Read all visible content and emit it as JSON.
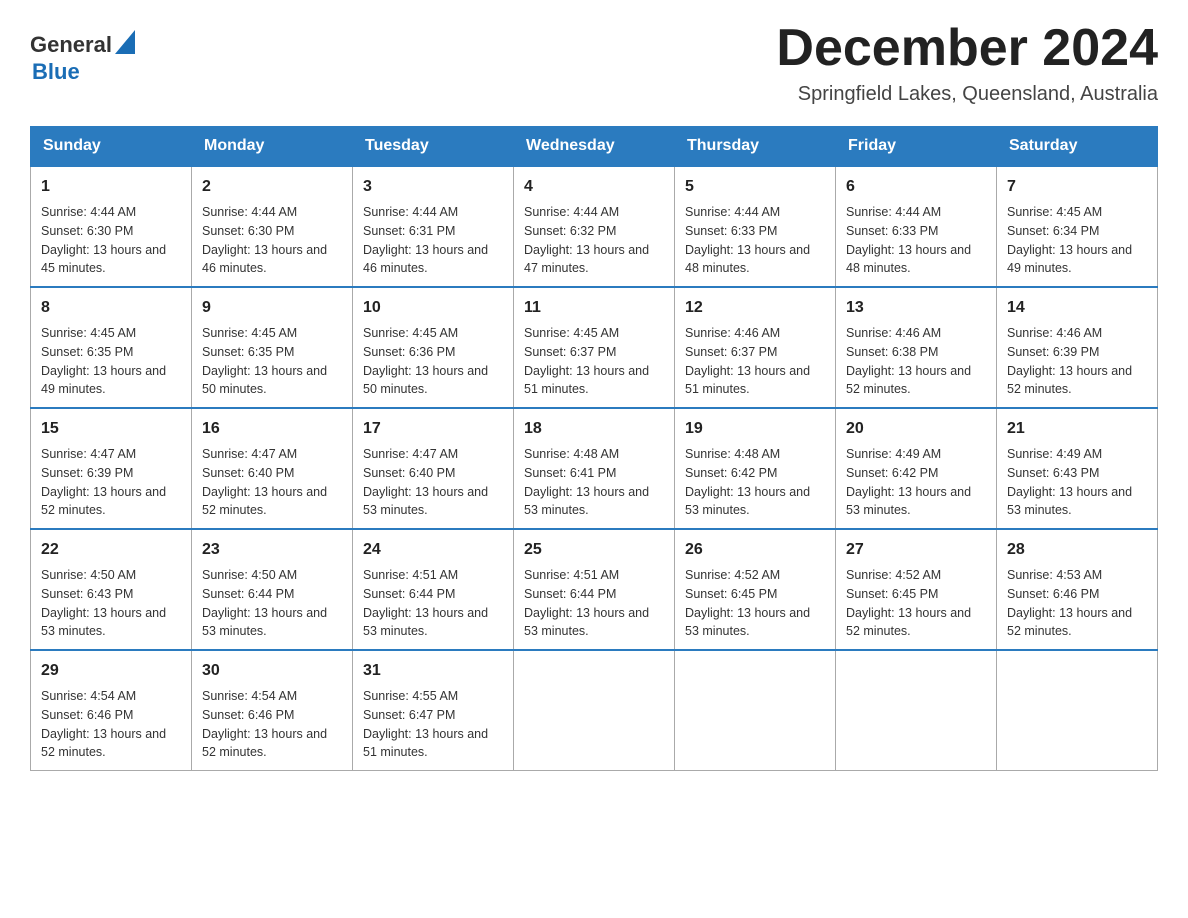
{
  "header": {
    "title": "December 2024",
    "subtitle": "Springfield Lakes, Queensland, Australia",
    "logo_general": "General",
    "logo_blue": "Blue"
  },
  "weekdays": [
    "Sunday",
    "Monday",
    "Tuesday",
    "Wednesday",
    "Thursday",
    "Friday",
    "Saturday"
  ],
  "weeks": [
    [
      {
        "day": "1",
        "sunrise": "4:44 AM",
        "sunset": "6:30 PM",
        "daylight": "13 hours and 45 minutes."
      },
      {
        "day": "2",
        "sunrise": "4:44 AM",
        "sunset": "6:30 PM",
        "daylight": "13 hours and 46 minutes."
      },
      {
        "day": "3",
        "sunrise": "4:44 AM",
        "sunset": "6:31 PM",
        "daylight": "13 hours and 46 minutes."
      },
      {
        "day": "4",
        "sunrise": "4:44 AM",
        "sunset": "6:32 PM",
        "daylight": "13 hours and 47 minutes."
      },
      {
        "day": "5",
        "sunrise": "4:44 AM",
        "sunset": "6:33 PM",
        "daylight": "13 hours and 48 minutes."
      },
      {
        "day": "6",
        "sunrise": "4:44 AM",
        "sunset": "6:33 PM",
        "daylight": "13 hours and 48 minutes."
      },
      {
        "day": "7",
        "sunrise": "4:45 AM",
        "sunset": "6:34 PM",
        "daylight": "13 hours and 49 minutes."
      }
    ],
    [
      {
        "day": "8",
        "sunrise": "4:45 AM",
        "sunset": "6:35 PM",
        "daylight": "13 hours and 49 minutes."
      },
      {
        "day": "9",
        "sunrise": "4:45 AM",
        "sunset": "6:35 PM",
        "daylight": "13 hours and 50 minutes."
      },
      {
        "day": "10",
        "sunrise": "4:45 AM",
        "sunset": "6:36 PM",
        "daylight": "13 hours and 50 minutes."
      },
      {
        "day": "11",
        "sunrise": "4:45 AM",
        "sunset": "6:37 PM",
        "daylight": "13 hours and 51 minutes."
      },
      {
        "day": "12",
        "sunrise": "4:46 AM",
        "sunset": "6:37 PM",
        "daylight": "13 hours and 51 minutes."
      },
      {
        "day": "13",
        "sunrise": "4:46 AM",
        "sunset": "6:38 PM",
        "daylight": "13 hours and 52 minutes."
      },
      {
        "day": "14",
        "sunrise": "4:46 AM",
        "sunset": "6:39 PM",
        "daylight": "13 hours and 52 minutes."
      }
    ],
    [
      {
        "day": "15",
        "sunrise": "4:47 AM",
        "sunset": "6:39 PM",
        "daylight": "13 hours and 52 minutes."
      },
      {
        "day": "16",
        "sunrise": "4:47 AM",
        "sunset": "6:40 PM",
        "daylight": "13 hours and 52 minutes."
      },
      {
        "day": "17",
        "sunrise": "4:47 AM",
        "sunset": "6:40 PM",
        "daylight": "13 hours and 53 minutes."
      },
      {
        "day": "18",
        "sunrise": "4:48 AM",
        "sunset": "6:41 PM",
        "daylight": "13 hours and 53 minutes."
      },
      {
        "day": "19",
        "sunrise": "4:48 AM",
        "sunset": "6:42 PM",
        "daylight": "13 hours and 53 minutes."
      },
      {
        "day": "20",
        "sunrise": "4:49 AM",
        "sunset": "6:42 PM",
        "daylight": "13 hours and 53 minutes."
      },
      {
        "day": "21",
        "sunrise": "4:49 AM",
        "sunset": "6:43 PM",
        "daylight": "13 hours and 53 minutes."
      }
    ],
    [
      {
        "day": "22",
        "sunrise": "4:50 AM",
        "sunset": "6:43 PM",
        "daylight": "13 hours and 53 minutes."
      },
      {
        "day": "23",
        "sunrise": "4:50 AM",
        "sunset": "6:44 PM",
        "daylight": "13 hours and 53 minutes."
      },
      {
        "day": "24",
        "sunrise": "4:51 AM",
        "sunset": "6:44 PM",
        "daylight": "13 hours and 53 minutes."
      },
      {
        "day": "25",
        "sunrise": "4:51 AM",
        "sunset": "6:44 PM",
        "daylight": "13 hours and 53 minutes."
      },
      {
        "day": "26",
        "sunrise": "4:52 AM",
        "sunset": "6:45 PM",
        "daylight": "13 hours and 53 minutes."
      },
      {
        "day": "27",
        "sunrise": "4:52 AM",
        "sunset": "6:45 PM",
        "daylight": "13 hours and 52 minutes."
      },
      {
        "day": "28",
        "sunrise": "4:53 AM",
        "sunset": "6:46 PM",
        "daylight": "13 hours and 52 minutes."
      }
    ],
    [
      {
        "day": "29",
        "sunrise": "4:54 AM",
        "sunset": "6:46 PM",
        "daylight": "13 hours and 52 minutes."
      },
      {
        "day": "30",
        "sunrise": "4:54 AM",
        "sunset": "6:46 PM",
        "daylight": "13 hours and 52 minutes."
      },
      {
        "day": "31",
        "sunrise": "4:55 AM",
        "sunset": "6:47 PM",
        "daylight": "13 hours and 51 minutes."
      },
      null,
      null,
      null,
      null
    ]
  ]
}
